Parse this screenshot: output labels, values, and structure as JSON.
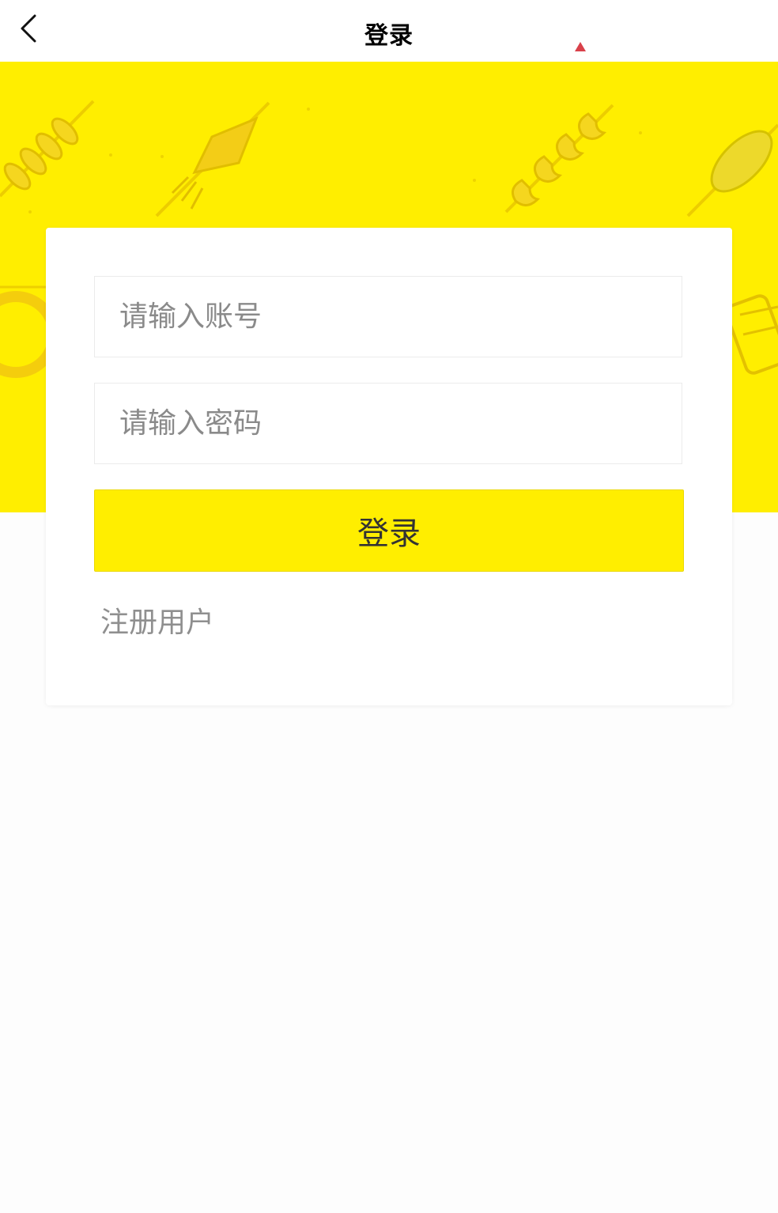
{
  "navbar": {
    "title": "登录",
    "back_icon": "chevron-left-icon",
    "indicator_icon": "triangle-up-icon",
    "indicator_color": "#d9414a"
  },
  "banner": {
    "background_color": "#ffee00",
    "illustration": "grilled-skewers-pattern"
  },
  "login_form": {
    "account_placeholder": "请输入账号",
    "password_placeholder": "请输入密码",
    "submit_label": "登录",
    "register_label": "注册用户"
  },
  "colors": {
    "accent": "#ffee00",
    "title_text": "#000000",
    "placeholder_text": "#8a8a8a",
    "link_text": "#8f8f8f"
  }
}
